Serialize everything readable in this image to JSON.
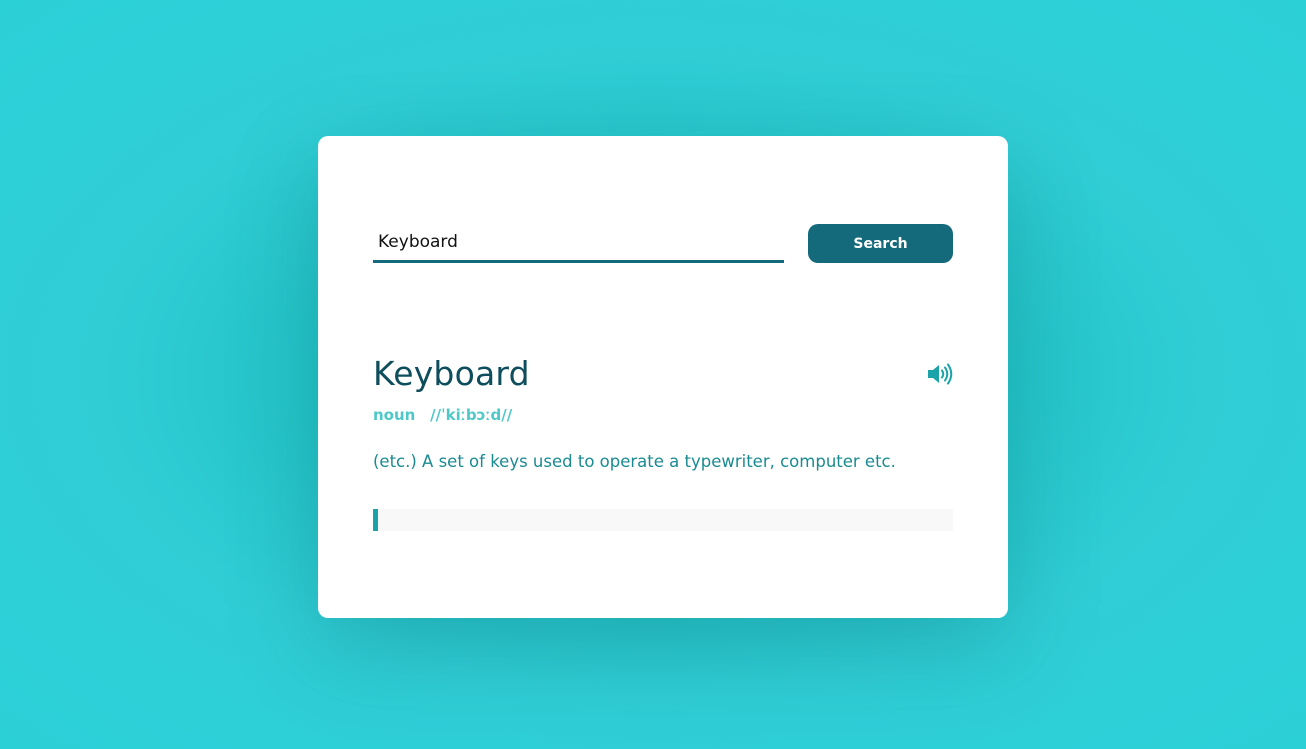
{
  "search": {
    "value": "Keyboard",
    "button_label": "Search"
  },
  "result": {
    "word": "Keyboard",
    "part_of_speech": "noun",
    "phonetic": "//ˈkiːbɔːd//",
    "definition": "(etc.) A set of keys used to operate a typewriter, computer etc.",
    "example": "",
    "sound_icon": "speaker-volume-icon"
  },
  "colors": {
    "background": "#2bcfd6",
    "card": "#ffffff",
    "accent_dark": "#146a7b",
    "title": "#0e4d5b",
    "meta": "#4fc8c8",
    "definition": "#1a8b91",
    "example_border": "#19a3a6"
  }
}
